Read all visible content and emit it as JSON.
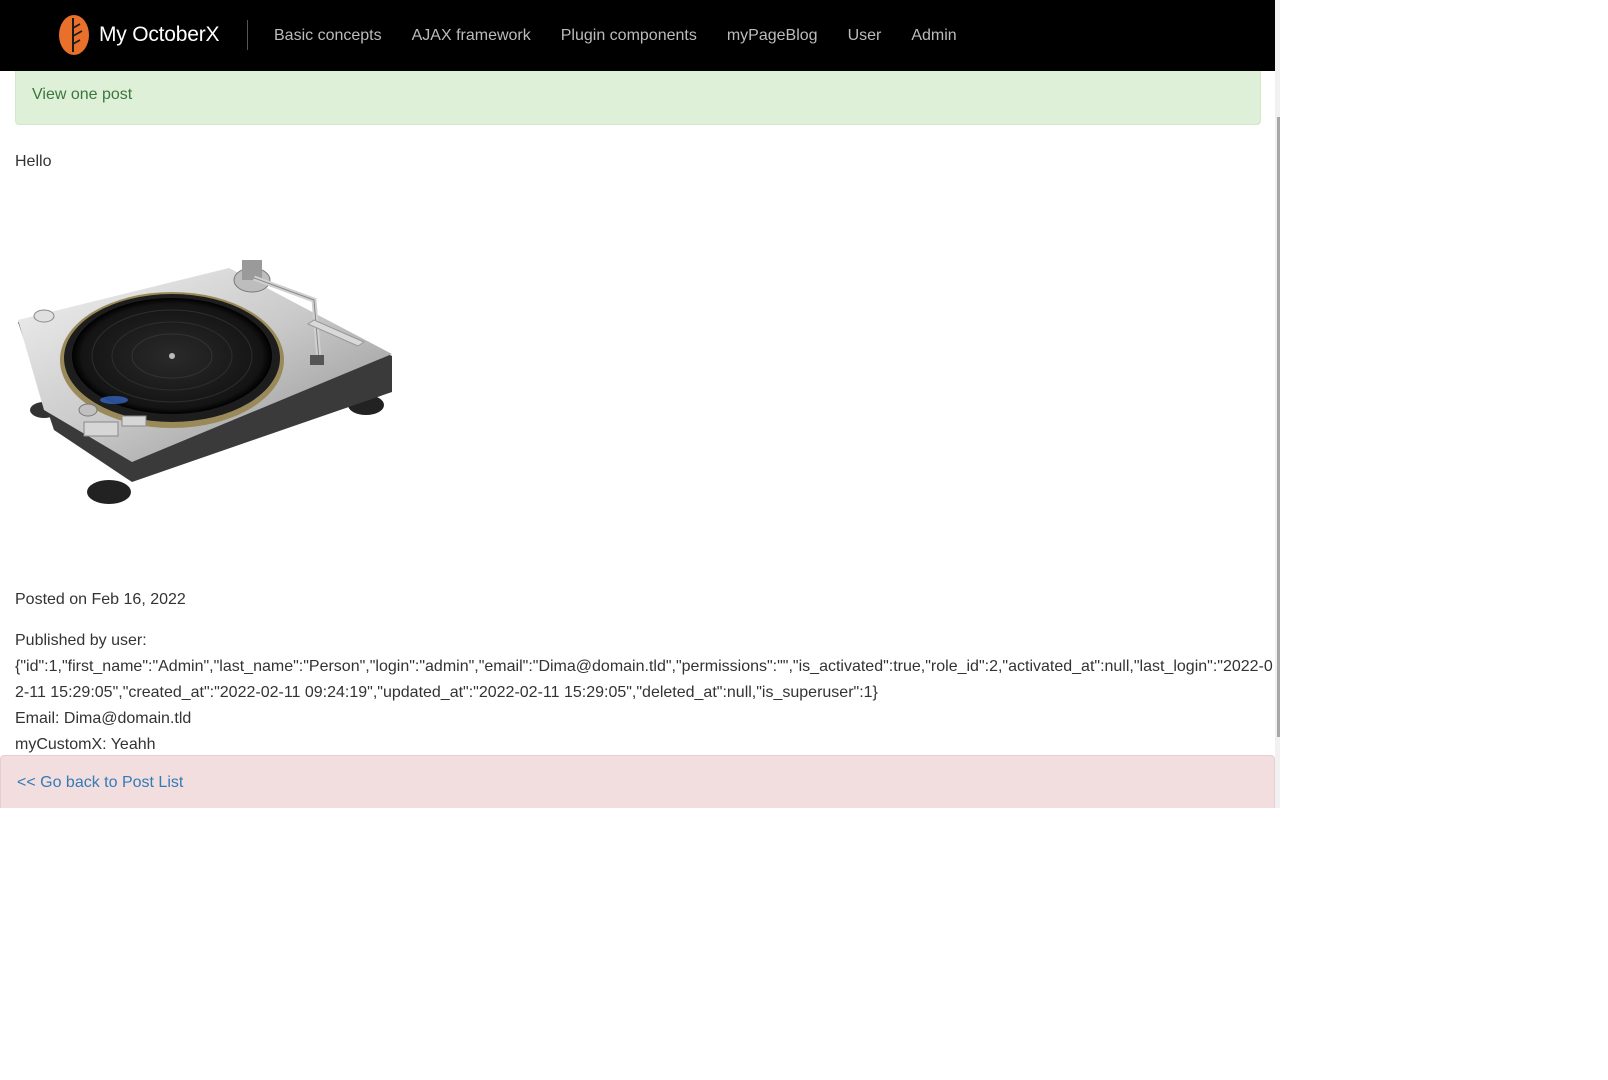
{
  "navbar": {
    "brand": "My OctoberX",
    "brand_logo_icon": "leaf-logo-icon",
    "links": [
      "Basic concepts",
      "AJAX framework",
      "Plugin components",
      "myPageBlog",
      "User",
      "Admin"
    ]
  },
  "alert_success": {
    "text": "View one post",
    "color": "#dff0d8"
  },
  "post": {
    "content": "Hello",
    "image_icon": "turntable-image",
    "posted_on": "Posted on Feb 16, 2022",
    "published_by_label": "Published by user:",
    "user_json": "{\"id\":1,\"first_name\":\"Admin\",\"last_name\":\"Person\",\"login\":\"admin\",\"email\":\"Dima@domain.tld\",\"permissions\":\"\",\"is_activated\":true,\"role_id\":2,\"activated_at\":null,\"last_login\":\"2022-02-11 15:29:05\",\"created_at\":\"2022-02-11 09:24:19\",\"updated_at\":\"2022-02-11 15:29:05\",\"deleted_at\":null,\"is_superuser\":1}",
    "email_line": "Email: Dima@domain.tld",
    "custom_line": "myCustomX: Yeahh"
  },
  "alert_danger": {
    "back_link": "<< Go back to Post List",
    "color": "#f2dede"
  },
  "scrollbar": {
    "up_icon": "scroll-up-arrow-icon",
    "down_icon": "scroll-down-arrow-icon"
  },
  "colors": {
    "navbar_bg": "#000000",
    "logo_orange": "#e8702a",
    "link_blue": "#337ab7"
  }
}
